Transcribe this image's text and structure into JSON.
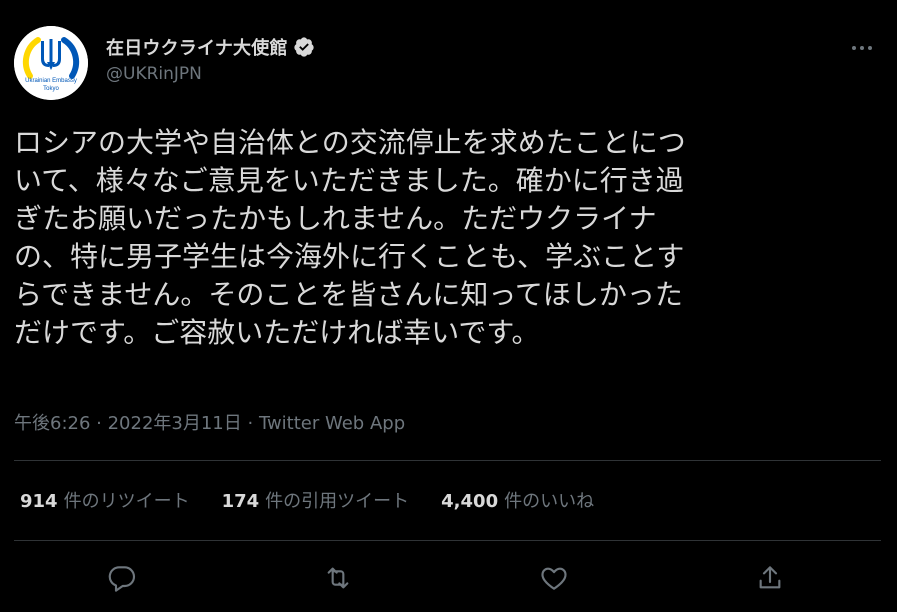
{
  "tweet": {
    "author": {
      "display_name": "在日ウクライナ大使館",
      "handle": "@UKRinJPN",
      "avatar_text_line1": "Ukrainian Embassy",
      "avatar_text_line2": "Tokyo",
      "verified": true
    },
    "text": "ロシアの大学や自治体との交流停止を求めたことにつ\nいて、様々なご意見をいただきました。確かに行き過\nぎたお願いだったかもしれません。ただウクライナ\nの、特に男子学生は今海外に行くことも、学ぶことす\nらできません。そのことを皆さんに知ってほしかった\nだけです。ご容赦いただければ幸いです。",
    "meta": {
      "time": "午後6:26",
      "separator1": " · ",
      "date": "2022年3月11日",
      "separator2": " · ",
      "source": "Twitter Web App"
    },
    "stats": {
      "retweets_count": "914",
      "retweets_label": "件のリツイート",
      "quotes_count": "174",
      "quotes_label": "件の引用ツイート",
      "likes_count": "4,400",
      "likes_label": "件のいいね"
    }
  },
  "icons": {
    "more": "more-icon",
    "verified": "verified-badge-icon",
    "reply": "reply-icon",
    "retweet": "retweet-icon",
    "like": "heart-icon",
    "share": "share-icon"
  },
  "colors": {
    "background": "#000000",
    "text_primary": "#d9d9d9",
    "text_secondary": "#6e767d",
    "divider": "#2f3336",
    "ukraine_blue": "#0057b7",
    "ukraine_yellow": "#ffd700"
  }
}
